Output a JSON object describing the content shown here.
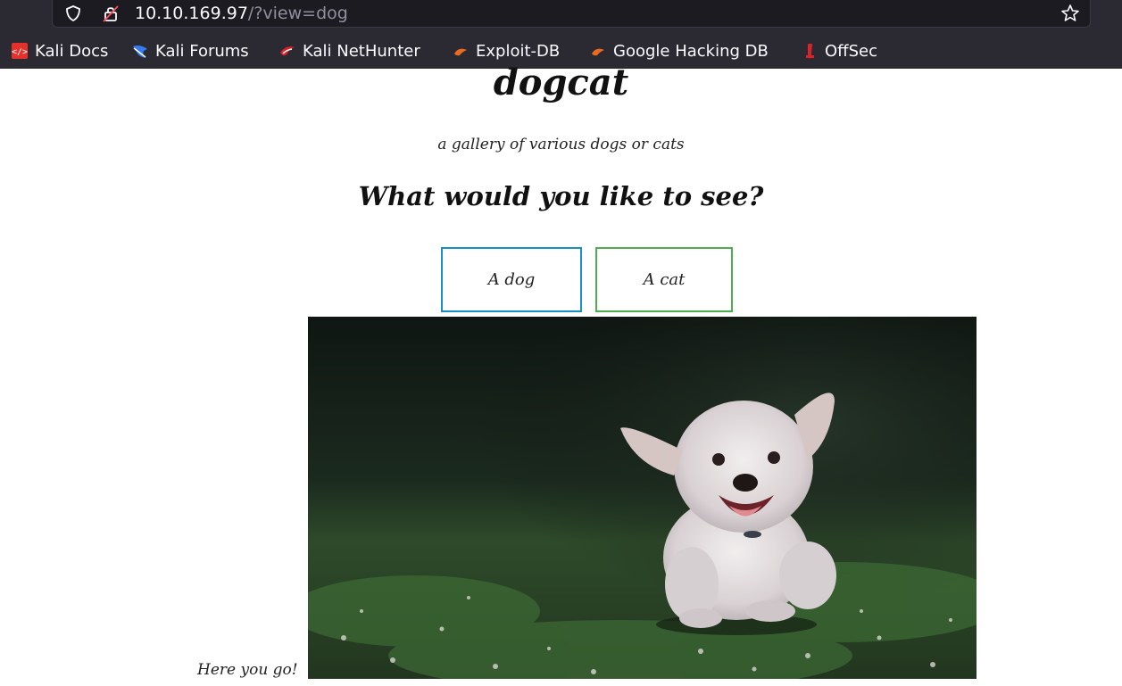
{
  "browser": {
    "url_host": "10.10.169.97",
    "url_path": "/?view=dog",
    "bookmarks": [
      {
        "label": "Kali Docs",
        "icon": "kali-docs-icon",
        "color": "#e5312c"
      },
      {
        "label": "Kali Forums",
        "icon": "kali-forums-icon",
        "color": "#367bf0"
      },
      {
        "label": "Kali NetHunter",
        "icon": "kali-nethunter-icon",
        "color": "#d9222a"
      },
      {
        "label": "Exploit-DB",
        "icon": "exploit-db-icon",
        "color": "#ec6a1d"
      },
      {
        "label": "Google Hacking DB",
        "icon": "google-hacking-db-icon",
        "color": "#ec6a1d"
      },
      {
        "label": "OffSec",
        "icon": "offsec-icon",
        "color": "#d9222a"
      }
    ]
  },
  "page": {
    "title": "dogcat",
    "subtitle": "a gallery of various dogs or cats",
    "question": "What would you like to see?",
    "buttons": {
      "dog": "A dog",
      "cat": "A cat"
    },
    "caption": "Here you go!",
    "image_alt": "dog-photo"
  }
}
